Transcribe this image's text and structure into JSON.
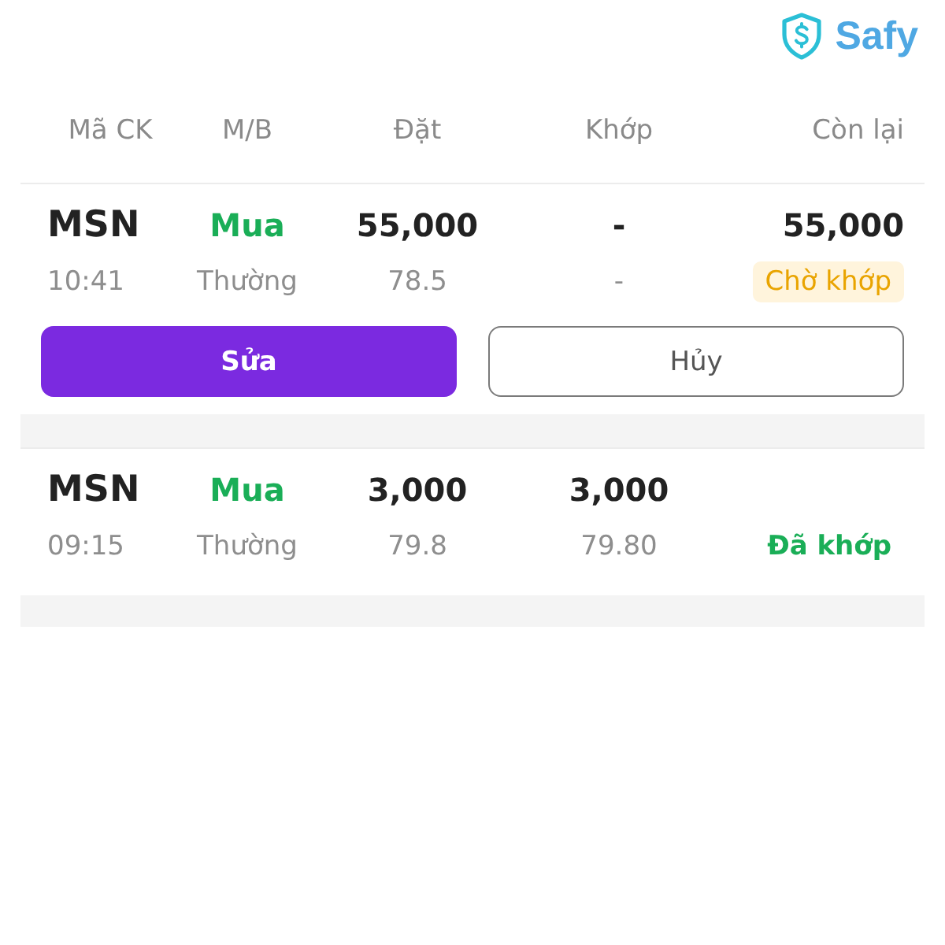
{
  "logo": {
    "text": "Safy"
  },
  "columns": [
    "Mã CK",
    "M/B",
    "Đặt",
    "Khớp",
    "Còn lại"
  ],
  "orders": [
    {
      "symbol": "MSN",
      "time": "10:41",
      "side": {
        "text": "Mua",
        "kind": "buy"
      },
      "order_type": "Thường",
      "quantity": "55,000",
      "price": "78.5",
      "matched_quantity": "-",
      "matched_price": "-",
      "remaining": "55,000",
      "status": {
        "text": "Chờ khớp",
        "kind": "pending"
      },
      "actions": [
        {
          "label": "Sửa",
          "kind": "edit"
        },
        {
          "label": "Hủy",
          "kind": "cancel"
        }
      ]
    },
    {
      "symbol": "MSN",
      "time": "09:15",
      "side": {
        "text": "Mua",
        "kind": "buy"
      },
      "order_type": "Thường",
      "quantity": "3,000",
      "price": "79.8",
      "matched_quantity": "3,000",
      "matched_price": "79.80",
      "status": {
        "text": "Đã khớp",
        "kind": "filled"
      }
    }
  ]
}
